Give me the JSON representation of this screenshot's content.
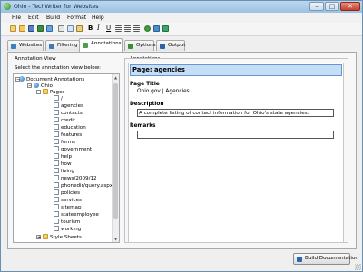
{
  "window": {
    "title": "Ohio - TechWriter for Websites"
  },
  "menu": [
    "File",
    "Edit",
    "Build",
    "Format",
    "Help"
  ],
  "tabs": [
    "Websites",
    "Filtering",
    "Annotations",
    "Options",
    "Output"
  ],
  "active_tab": "Annotations",
  "left_panel": {
    "group_label": "Annotation View",
    "instruction": "Select the annotation view below:",
    "tree": {
      "root": "Document Annotations",
      "site": "Ohio",
      "pages_folder": "Pages",
      "pages": [
        "/",
        "agencies",
        "contacts",
        "credit",
        "education",
        "features",
        "forms",
        "government",
        "help",
        "how",
        "living",
        "news/2009/12",
        "phonedir/query.aspx",
        "policies",
        "services",
        "sitemap",
        "stateemployee",
        "tourism",
        "working"
      ],
      "style_folder": "Style Sheets"
    }
  },
  "right_panel": {
    "group_label": "Annotations",
    "header": "Page: agencies",
    "page_title_label": "Page Title",
    "page_title_value": "Ohio.gov | Agencies",
    "description_label": "Description",
    "description_value": "A complete listing of contact information for Ohio's state agencies.",
    "remarks_label": "Remarks",
    "remarks_value": ""
  },
  "footer": {
    "build_button": "Build Documentation"
  },
  "toolbar": {
    "bold": "B",
    "italic": "I",
    "underline": "U"
  }
}
